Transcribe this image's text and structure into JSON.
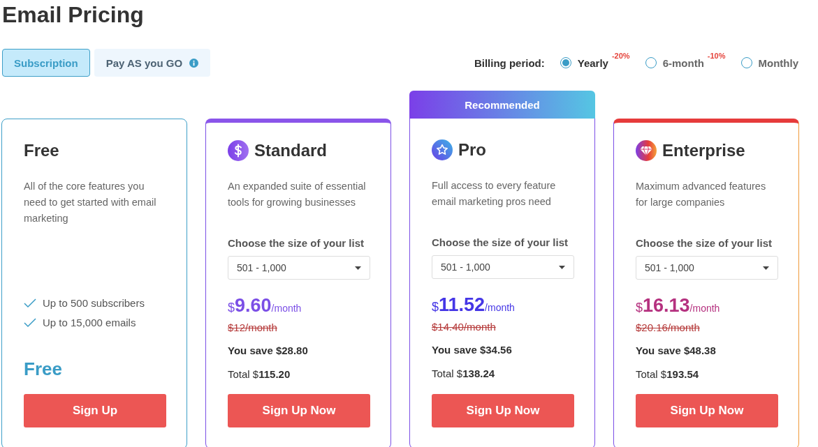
{
  "title": "Email Pricing",
  "tabs": [
    {
      "label": "Subscription",
      "selected": true,
      "info": false
    },
    {
      "label": "Pay AS you GO",
      "selected": false,
      "info": true
    }
  ],
  "billing": {
    "label": "Billing period:",
    "options": [
      {
        "label": "Yearly",
        "selected": true,
        "discount": "-20%"
      },
      {
        "label": "6-month",
        "selected": false,
        "discount": "-10%"
      },
      {
        "label": "Monthly",
        "selected": false
      }
    ]
  },
  "plans": [
    {
      "kind": "free",
      "name": "Free",
      "description": "All of the core features you need to get started with email marketing",
      "features": [
        "Up to 500 subscribers",
        "Up to 15,000 emails"
      ],
      "price": "Free",
      "button": "Sign Up"
    },
    {
      "kind": "paid",
      "name": "Standard",
      "color": "#7b4fe6",
      "description": "An expanded suite of essential tools for growing businesses",
      "list_label": "Choose the size of your list",
      "list_size": "501 - 1,000",
      "currency": "$",
      "amount": "9.60",
      "period": "/month",
      "old_price": "$12/month",
      "savings": "You save $28.80",
      "total_label": "Total $",
      "total": "115.20",
      "button": "Sign Up Now"
    },
    {
      "kind": "paid",
      "name": "Pro",
      "color": "#4536e6",
      "badge": "Recommended",
      "description": "Full access to every feature email marketing pros need",
      "list_label": "Choose the size of your list",
      "list_size": "501 - 1,000",
      "currency": "$",
      "amount": "11.52",
      "period": "/month",
      "old_price": "$14.40/month",
      "savings": "You save $34.56",
      "total_label": "Total $",
      "total": "138.24",
      "button": "Sign Up Now"
    },
    {
      "kind": "paid",
      "name": "Enterprise",
      "color": "#b5317f",
      "description": "Maximum advanced features for large companies",
      "list_label": "Choose the size of your list",
      "list_size": "501 - 1,000",
      "currency": "$",
      "amount": "16.13",
      "period": "/month",
      "old_price": "$20.16/month",
      "savings": "You save $48.38",
      "total_label": "Total $",
      "total": "193.54",
      "button": "Sign Up Now"
    }
  ]
}
